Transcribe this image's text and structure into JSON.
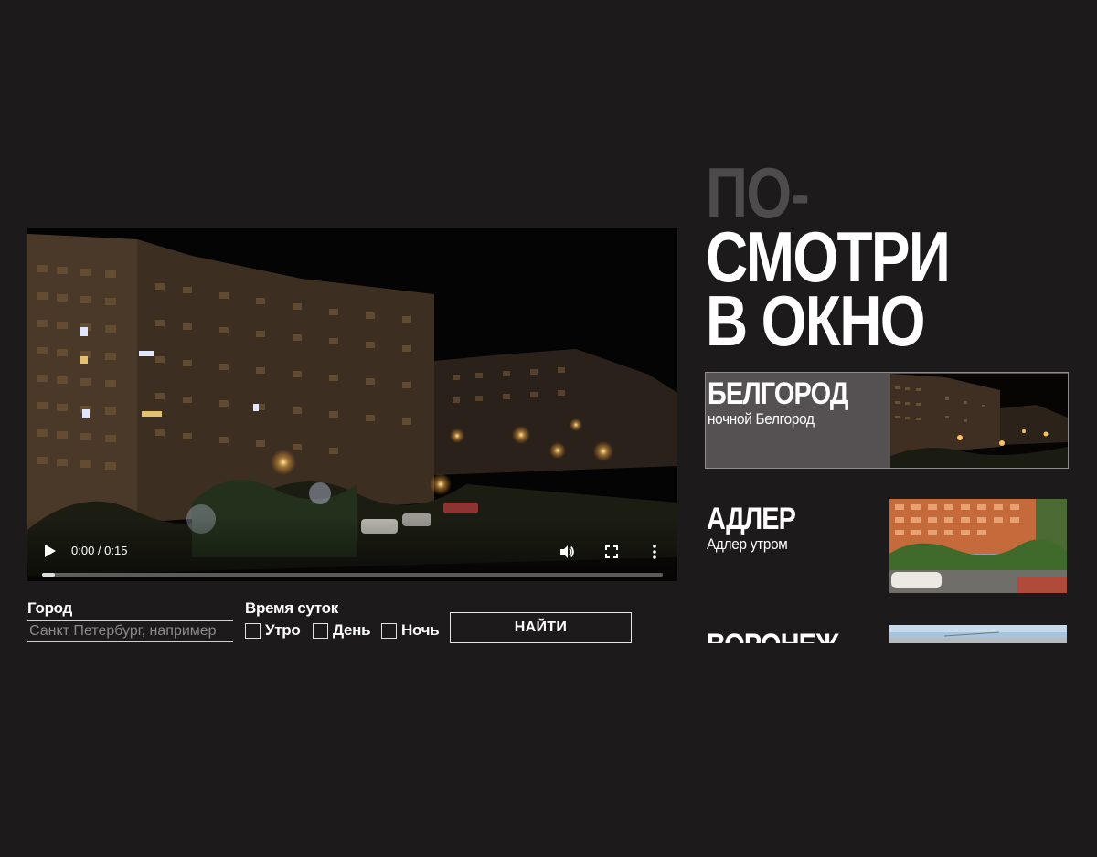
{
  "video": {
    "time": "0:00 / 0:15",
    "progress": 0.02
  },
  "search": {
    "city_label": "Город",
    "city_placeholder": "Санкт Петербург, например",
    "time_label": "Время суток",
    "options": [
      "Утро",
      "День",
      "Ночь"
    ],
    "find_label": "НАЙТИ"
  },
  "heading": {
    "line1": "ПО-",
    "line2": "СМОТРИ",
    "line3": "В ОКНО"
  },
  "cities": [
    {
      "title": "БЕЛГОРОД",
      "subtitle": "ночной Белгород",
      "active": true
    },
    {
      "title": "АДЛЕР",
      "subtitle": "Адлер утром",
      "active": false
    },
    {
      "title": "ВОРОНЕЖ",
      "subtitle": "",
      "active": false
    }
  ],
  "colors": {
    "background": "#1c1a1b",
    "heading_muted": "#4d4b4c",
    "active_card": "#555152"
  },
  "icons": [
    "play-icon",
    "volume-icon",
    "fullscreen-icon",
    "more-vertical-icon"
  ]
}
